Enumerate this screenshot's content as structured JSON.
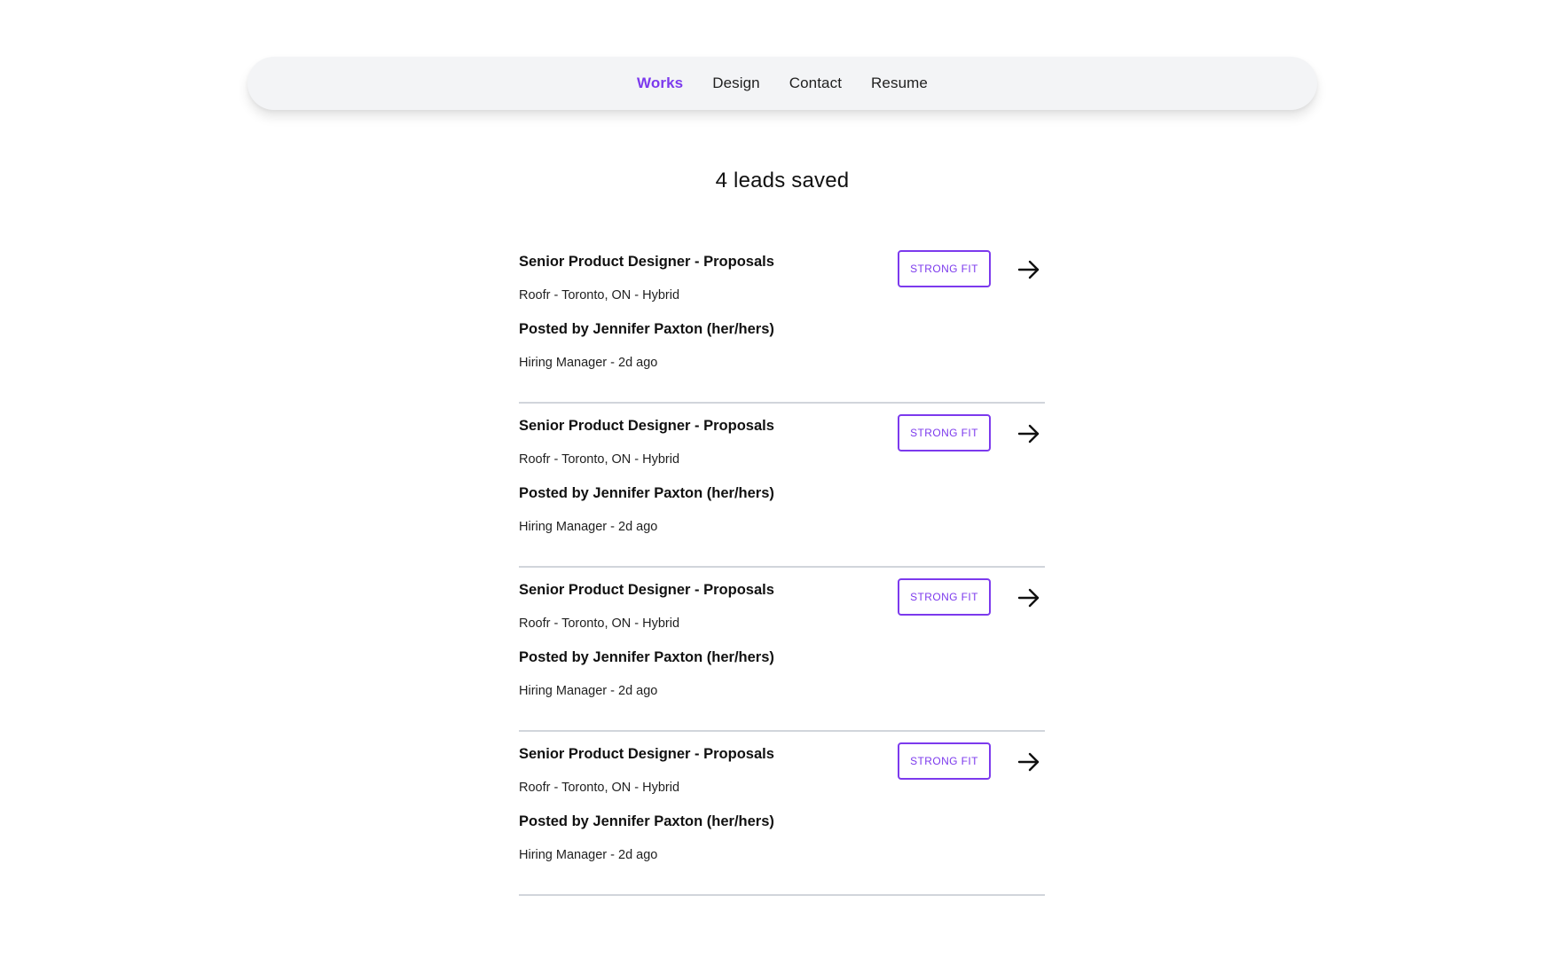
{
  "nav": {
    "items": [
      {
        "label": "Works",
        "active": true
      },
      {
        "label": "Design",
        "active": false
      },
      {
        "label": "Contact",
        "active": false
      },
      {
        "label": "Resume",
        "active": false
      }
    ],
    "active_color": "#7c3aed"
  },
  "heading": "4 leads saved",
  "leads": [
    {
      "title": "Senior Product Designer - Proposals",
      "meta": "Roofr - Toronto, ON - Hybrid",
      "poster": "Posted by Jennifer Paxton (her/hers)",
      "role": "Hiring Manager - 2d ago",
      "badge": "STRONG FIT",
      "action_icon": "arrow-right-icon"
    },
    {
      "title": "Senior Product Designer - Proposals",
      "meta": "Roofr - Toronto, ON - Hybrid",
      "poster": "Posted by Jennifer Paxton (her/hers)",
      "role": "Hiring Manager - 2d ago",
      "badge": "STRONG FIT",
      "action_icon": "arrow-right-icon"
    },
    {
      "title": "Senior Product Designer - Proposals",
      "meta": "Roofr - Toronto, ON - Hybrid",
      "poster": "Posted by Jennifer Paxton (her/hers)",
      "role": "Hiring Manager - 2d ago",
      "badge": "STRONG FIT",
      "action_icon": "arrow-right-icon"
    },
    {
      "title": "Senior Product Designer - Proposals",
      "meta": "Roofr - Toronto, ON - Hybrid",
      "poster": "Posted by Jennifer Paxton (her/hers)",
      "role": "Hiring Manager - 2d ago",
      "badge": "STRONG FIT",
      "action_icon": "arrow-right-icon"
    }
  ],
  "colors": {
    "accent": "#7c3aed",
    "divider": "#d1d5db",
    "nav_background": "#f3f4f6"
  }
}
